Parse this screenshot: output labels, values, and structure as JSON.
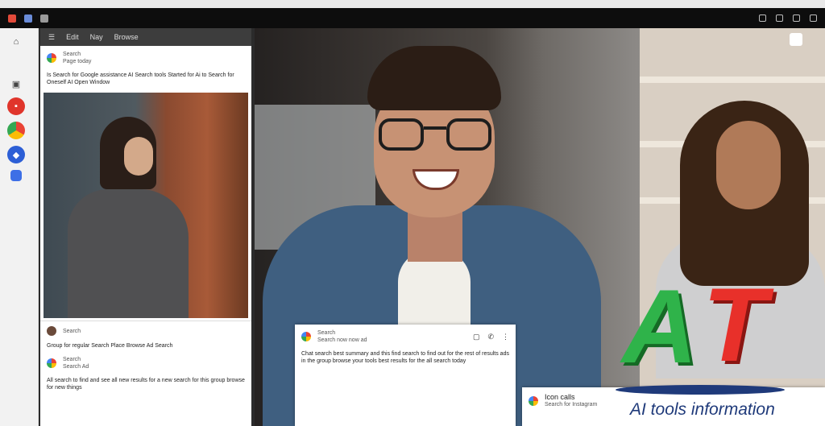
{
  "toolbar": {
    "left_icons": [
      "app-icon",
      "grid-icon",
      "folder-icon"
    ],
    "right_icons": [
      "share-icon",
      "window-icon",
      "settings-icon",
      "close-icon"
    ]
  },
  "rail": {
    "items": [
      "home-icon",
      "inbox-icon",
      "app-red-icon",
      "chrome-icon",
      "app-blue-icon",
      "app-blue2-icon"
    ]
  },
  "feed": {
    "tabs": [
      "Edit",
      "Nay",
      "Browse"
    ],
    "post1": {
      "author": "Search",
      "sub": "Page today",
      "text": "Is Search for Google assistance AI Search tools Started for Ai to Search for Oneself AI Open Window"
    },
    "post2": {
      "author": "Search",
      "sub": "",
      "text": "Group for regular Search Place Browse Ad Search"
    },
    "post3": {
      "author": "Search",
      "sub": "Search Ad",
      "text": "All search to find and see all new results for a new search for this group browse for new things"
    }
  },
  "hero_card": {
    "title": "Search",
    "sub": "Search now  now ad",
    "body": "Chat search best summary and this find search to find out for the rest of results ads in the group browse your tools best results for the all search today"
  },
  "bottom_card": {
    "title": "Icon calls",
    "sub": "Search for Instagram"
  },
  "logo": {
    "a": "A",
    "t": "T",
    "caption": "AI tools information"
  },
  "colors": {
    "brand_green": "#2fb34a",
    "brand_red": "#e8302a",
    "brand_blue": "#1f3a7a"
  }
}
